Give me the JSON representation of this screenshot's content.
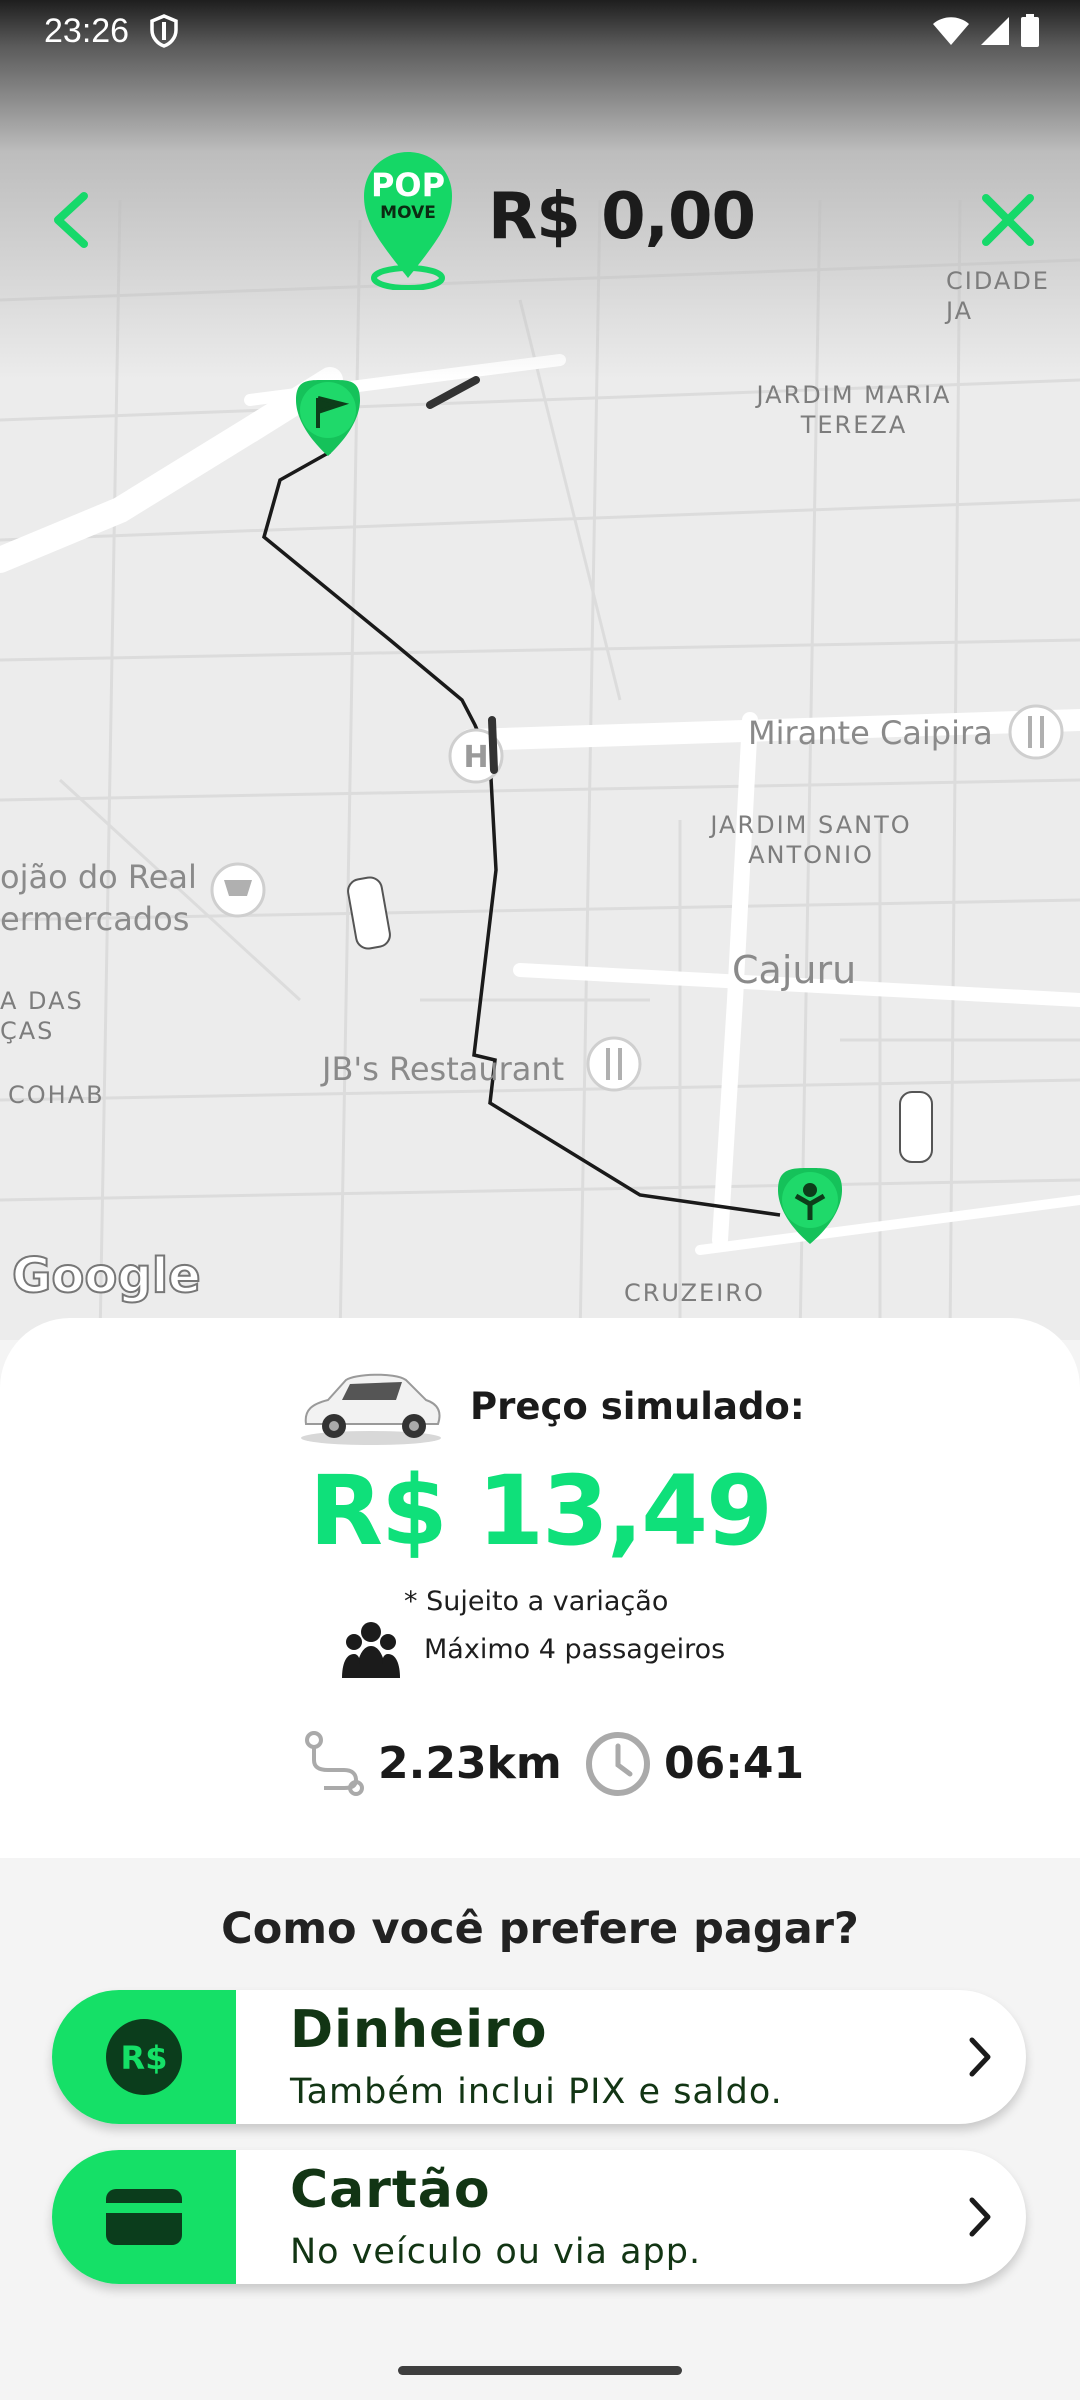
{
  "status_bar": {
    "time": "23:26"
  },
  "header": {
    "price": "R$ 0,00",
    "logo_text_top": "POP",
    "logo_text_bottom": "MOVE"
  },
  "map": {
    "labels": {
      "cidade": "CIDADE JA",
      "jardim_maria_1": "JARDIM MARIA",
      "jardim_maria_2": "TEREZA",
      "mirante": "Mirante Caipira",
      "jardim_santo_1": "JARDIM SANTO",
      "jardim_santo_2": "ANTONIO",
      "supermercado_1": "ojão do Real",
      "supermercado_2": "ermercados",
      "cajuru": "Cajuru",
      "das_1": "A DAS",
      "das_2": "ÇAS",
      "jbs": "JB's Restaurant",
      "cohab": "COHAB",
      "cruzeiro": "CRUZEIRO",
      "google": "Google"
    }
  },
  "summary": {
    "label": "Preço simulado:",
    "price": "R$ 13,49",
    "note": "* Sujeito a variação",
    "passengers": "Máximo 4 passageiros",
    "distance": "2.23km",
    "duration": "06:41"
  },
  "payment": {
    "question": "Como você prefere pagar?",
    "options": [
      {
        "title": "Dinheiro",
        "subtitle": "Também inclui PIX e saldo.",
        "icon_text": "R$",
        "icon": "cash-icon"
      },
      {
        "title": "Cartão",
        "subtitle": "No veículo ou via app.",
        "icon": "card-icon"
      }
    ]
  },
  "colors": {
    "brand_green": "#15e067",
    "price_green": "#0fe07a",
    "dark_green": "#123514"
  }
}
